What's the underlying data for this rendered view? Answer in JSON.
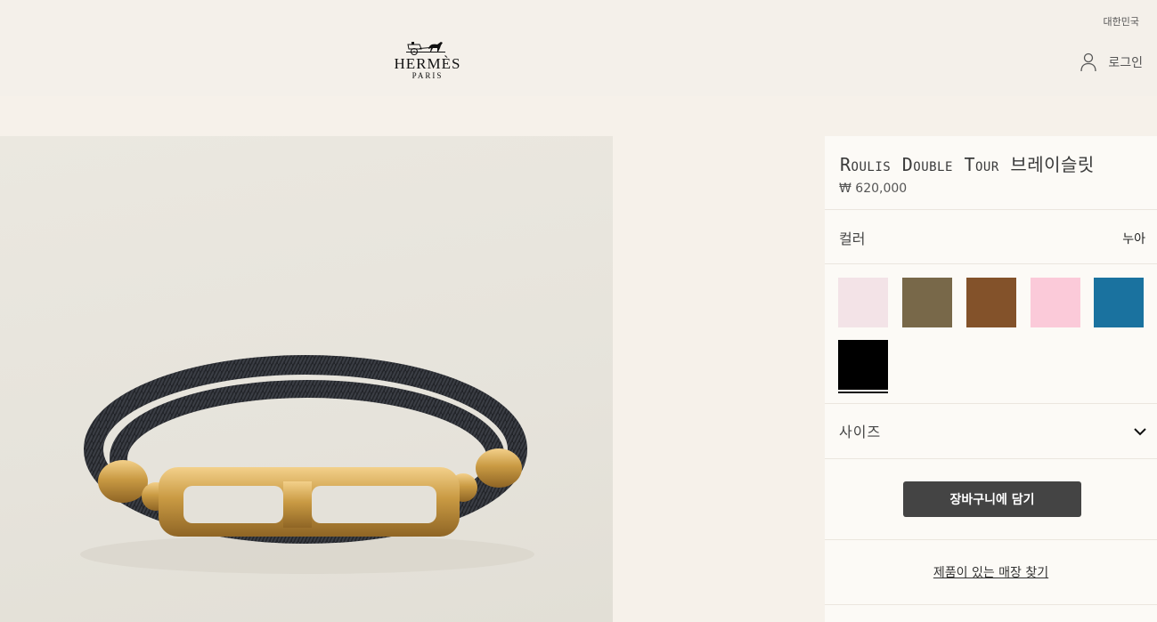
{
  "header": {
    "region": "대한민국",
    "logo_brand": "HERMÈS",
    "logo_city": "PARIS",
    "login_label": "로그인"
  },
  "product": {
    "name": "Roulis Double Tour 브레이슬릿",
    "price": "₩ 620,000"
  },
  "color": {
    "label": "컬러",
    "selected": "누아",
    "swatches": [
      "#f3e3e7",
      "#786849",
      "#83522a",
      "#fbcad9",
      "#1a729f",
      "#000000"
    ]
  },
  "size": {
    "label": "사이즈"
  },
  "actions": {
    "add_to_cart": "장바구니에 담기",
    "find_store": "제품이 있는 매장 찾기"
  },
  "icons": [
    "user-icon",
    "chevron-down-icon",
    "hermes-carriage-logo-icon"
  ]
}
